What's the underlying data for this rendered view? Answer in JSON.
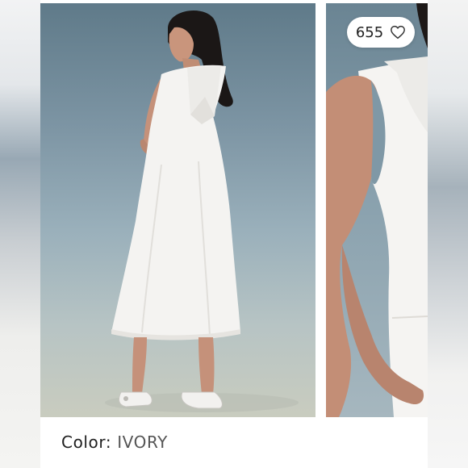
{
  "listing": {
    "like_count": "655",
    "color_label": "Color:",
    "color_value": "IVORY"
  },
  "icons": {
    "like": "heart-outline-icon"
  },
  "colors": {
    "dress": "#f4f3f1",
    "backdrop_top": "#5f7a89",
    "backdrop_bottom": "#c9ccbf",
    "badge": "#ffffff"
  }
}
